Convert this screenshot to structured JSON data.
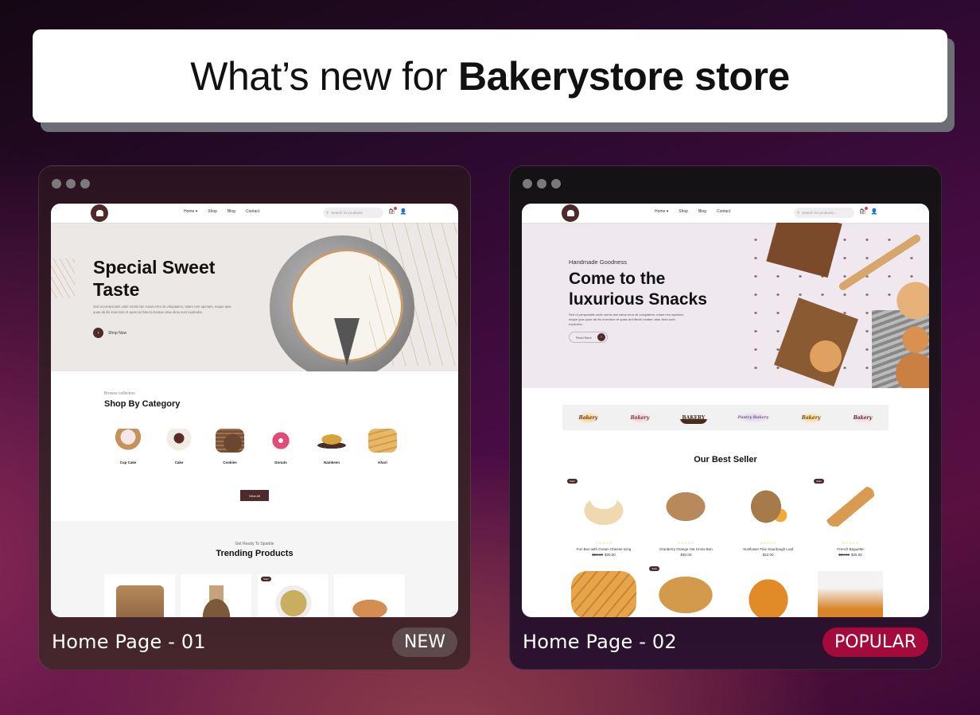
{
  "headline": {
    "prefix": "What’s new for",
    "brand": "Bakerystore store"
  },
  "cards": [
    {
      "title": "Home Page - 01",
      "badge": "NEW",
      "badge_color": "#5e4a4c",
      "site": {
        "nav": [
          "Home ▾",
          "Shop",
          "Blog",
          "Contact"
        ],
        "search_placeholder": "Search for products",
        "hero": {
          "title_line1": "Special Sweet",
          "title_line2": "Taste",
          "paragraph": "Sed ut perspiciatis unde omnis iste natus error sit voluptatem, totam rem aperiam, eaque ipsa quae ab illo inventore et quasi architecto beatae vitae dicta sunt explicabo.",
          "cta": "Shop Now"
        },
        "categories_section": {
          "kicker": "Browse collection",
          "title": "Shop By Category",
          "items": [
            "Cup Cake",
            "Cake",
            "Cookies",
            "Donuts",
            "Namkeen",
            "Khari"
          ],
          "view_all": "View All"
        },
        "trending_section": {
          "kicker": "Get Ready To Sparkle",
          "title": "Trending Products",
          "sale_label": "Sale!"
        }
      }
    },
    {
      "title": "Home Page - 02",
      "badge": "POPULAR",
      "badge_color": "#a40b3c",
      "site": {
        "nav": [
          "Home ▾",
          "Shop",
          "Blog",
          "Contact"
        ],
        "search_placeholder": "Search for products...",
        "hero": {
          "kicker": "Handmade Goodness",
          "title_line1": "Come to the",
          "title_line2": "luxurious Snacks",
          "paragraph": "Sed ut perspiciatis unde omnis iste natus error sit voluptatem, totam rem aperiam, eaque ipsa quae ab illo inventore et quasi architecto beatae vitae dicta sunt explicabo.",
          "cta": "Read More"
        },
        "brands": [
          "Bakery",
          "Bakery",
          "BAKERY",
          "Pastry Bakery",
          "Bakery",
          "Bakery"
        ],
        "best_seller": {
          "title": "Our Best Seller",
          "sale_label": "Sale!",
          "stars": "☆☆☆☆☆",
          "products": [
            {
              "name": "Fun Bun with Cream Cheese Icing",
              "old_price": "$50.00",
              "price": "$30.00",
              "sale": true
            },
            {
              "name": "Cranberry Orange Hot Cross Bun",
              "old_price": "",
              "price": "$30.00",
              "sale": false
            },
            {
              "name": "Sunflower Flax Sourdough Loaf",
              "old_price": "",
              "price": "$22.00",
              "sale": false
            },
            {
              "name": "French Baguette",
              "old_price": "$28.00",
              "price": "$25.00",
              "sale": true
            }
          ]
        }
      }
    }
  ],
  "colors": {
    "brand_brown": "#4e2a2b",
    "popular": "#a40b3c",
    "new": "#5e4a4c",
    "star": "#e0a830"
  }
}
